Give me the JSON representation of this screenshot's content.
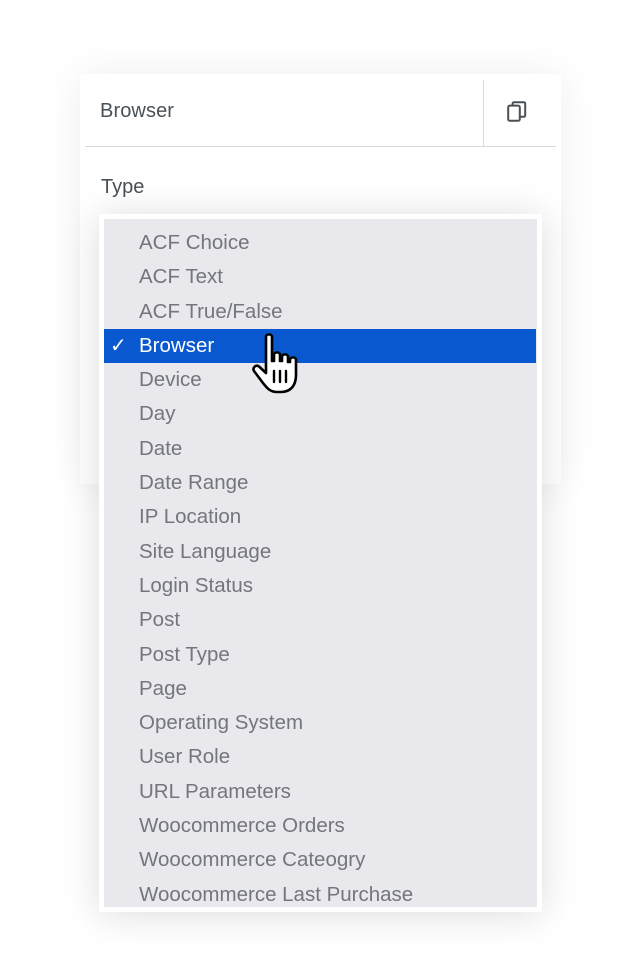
{
  "panel": {
    "title": "Browser",
    "copy_icon": "copy-icon",
    "field_label": "Type"
  },
  "dropdown": {
    "selected": "Browser",
    "check_mark": "✓",
    "options": [
      "ACF Choice",
      "ACF Text",
      "ACF True/False",
      "Browser",
      "Device",
      "Day",
      "Date",
      "Date Range",
      "IP Location",
      "Site Language",
      "Login Status",
      "Post",
      "Post Type",
      "Page",
      "Operating System",
      "User Role",
      "URL Parameters",
      "Woocommerce Orders",
      "Woocommerce Cateogry",
      "Woocommerce Last Purchase"
    ]
  },
  "colors": {
    "selected_bg": "#0a58cf",
    "list_bg": "#e8e8ed",
    "option_text": "#73767b",
    "label_text": "#495157"
  },
  "pointer": "hand-pointer-icon"
}
